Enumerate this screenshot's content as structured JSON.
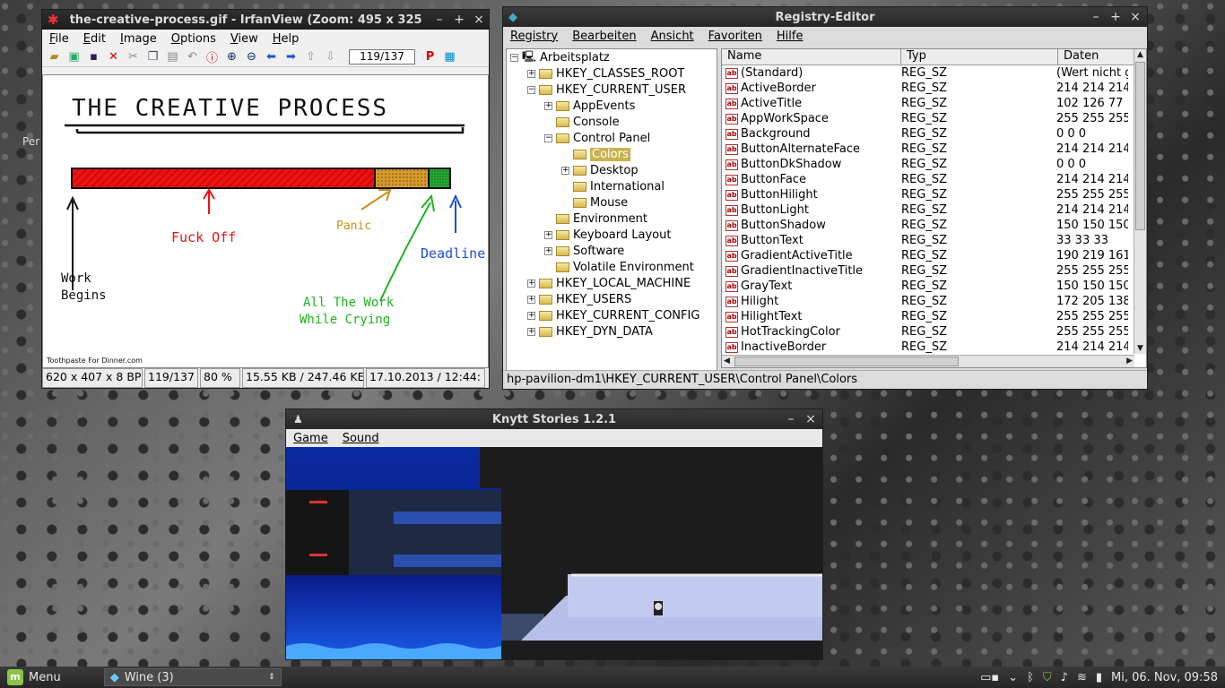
{
  "desktop": {
    "label": "Per"
  },
  "irfanview": {
    "title": "the-creative-process.gif - IrfanView (Zoom: 495 x 325",
    "menu": [
      "File",
      "Edit",
      "Image",
      "Options",
      "View",
      "Help"
    ],
    "page_box": "119/137",
    "image": {
      "title": "THE CREATIVE PROCESS",
      "labels": {
        "fuck_off": "Fuck Off",
        "panic": "Panic",
        "deadline": "Deadline",
        "work_begins_1": "Work",
        "work_begins_2": "Begins",
        "crying_1": "All The Work",
        "crying_2": "While Crying"
      },
      "credit": "Toothpaste For Dinner.com"
    },
    "status": [
      "620 x 407 x 8 BP",
      "119/137",
      "80 %",
      "15.55 KB / 247.46 KE",
      "17.10.2013 / 12:44:"
    ]
  },
  "registry": {
    "title": "Registry-Editor",
    "menu": [
      "Registry",
      "Bearbeiten",
      "Ansicht",
      "Favoriten",
      "Hilfe"
    ],
    "tree": [
      {
        "label": "Arbeitsplatz",
        "level": 0,
        "pm": "-",
        "icon": "computer"
      },
      {
        "label": "HKEY_CLASSES_ROOT",
        "level": 1,
        "pm": "+"
      },
      {
        "label": "HKEY_CURRENT_USER",
        "level": 1,
        "pm": "-"
      },
      {
        "label": "AppEvents",
        "level": 2,
        "pm": "+"
      },
      {
        "label": "Console",
        "level": 2,
        "pm": ""
      },
      {
        "label": "Control Panel",
        "level": 2,
        "pm": "-"
      },
      {
        "label": "Colors",
        "level": 3,
        "pm": "",
        "selected": true
      },
      {
        "label": "Desktop",
        "level": 3,
        "pm": "+"
      },
      {
        "label": "International",
        "level": 3,
        "pm": ""
      },
      {
        "label": "Mouse",
        "level": 3,
        "pm": ""
      },
      {
        "label": "Environment",
        "level": 2,
        "pm": ""
      },
      {
        "label": "Keyboard Layout",
        "level": 2,
        "pm": "+"
      },
      {
        "label": "Software",
        "level": 2,
        "pm": "+"
      },
      {
        "label": "Volatile Environment",
        "level": 2,
        "pm": ""
      },
      {
        "label": "HKEY_LOCAL_MACHINE",
        "level": 1,
        "pm": "+"
      },
      {
        "label": "HKEY_USERS",
        "level": 1,
        "pm": "+"
      },
      {
        "label": "HKEY_CURRENT_CONFIG",
        "level": 1,
        "pm": "+"
      },
      {
        "label": "HKEY_DYN_DATA",
        "level": 1,
        "pm": "+"
      }
    ],
    "columns": [
      "Name",
      "Typ",
      "Daten"
    ],
    "rows": [
      [
        "(Standard)",
        "REG_SZ",
        "(Wert nicht g"
      ],
      [
        "ActiveBorder",
        "REG_SZ",
        "214 214 214"
      ],
      [
        "ActiveTitle",
        "REG_SZ",
        "102 126 77"
      ],
      [
        "AppWorkSpace",
        "REG_SZ",
        "255 255 255"
      ],
      [
        "Background",
        "REG_SZ",
        "0 0 0"
      ],
      [
        "ButtonAlternateFace",
        "REG_SZ",
        "214 214 214"
      ],
      [
        "ButtonDkShadow",
        "REG_SZ",
        "0 0 0"
      ],
      [
        "ButtonFace",
        "REG_SZ",
        "214 214 214"
      ],
      [
        "ButtonHilight",
        "REG_SZ",
        "255 255 255"
      ],
      [
        "ButtonLight",
        "REG_SZ",
        "214 214 214"
      ],
      [
        "ButtonShadow",
        "REG_SZ",
        "150 150 150"
      ],
      [
        "ButtonText",
        "REG_SZ",
        "33 33 33"
      ],
      [
        "GradientActiveTitle",
        "REG_SZ",
        "190 219 161"
      ],
      [
        "GradientInactiveTitle",
        "REG_SZ",
        "255 255 255"
      ],
      [
        "GrayText",
        "REG_SZ",
        "150 150 150"
      ],
      [
        "Hilight",
        "REG_SZ",
        "172 205 138"
      ],
      [
        "HilightText",
        "REG_SZ",
        "255 255 255"
      ],
      [
        "HotTrackingColor",
        "REG_SZ",
        "255 255 255"
      ],
      [
        "InactiveBorder",
        "REG_SZ",
        "214 214 214"
      ]
    ],
    "status": "hp-pavilion-dm1\\HKEY_CURRENT_USER\\Control Panel\\Colors"
  },
  "knytt": {
    "title": "Knytt Stories 1.2.1",
    "menu": [
      "Game",
      "Sound"
    ]
  },
  "taskbar": {
    "menu_label": "Menu",
    "task_label": "Wine (3)",
    "clock": "Mi, 06. Nov, 09:58"
  }
}
